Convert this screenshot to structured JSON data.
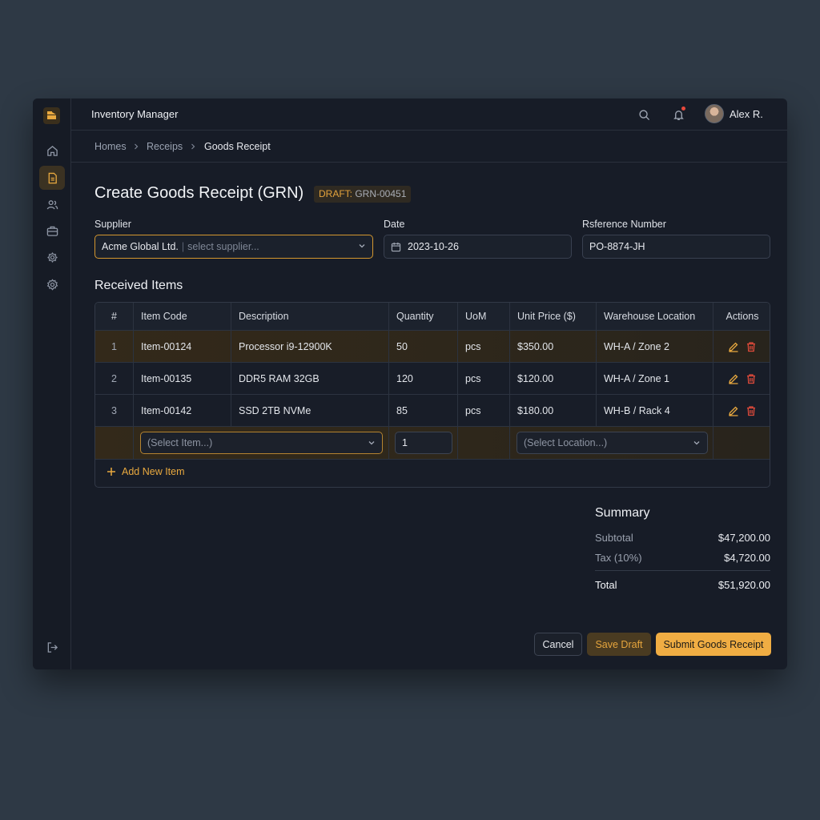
{
  "app": {
    "title": "Inventory Manager"
  },
  "user": {
    "name": "Alex R."
  },
  "breadcrumb": [
    "Homes",
    "Receips",
    "Goods Receipt"
  ],
  "page": {
    "title": "Create Goods Receipt (GRN)",
    "badge_label": "DRAFT:",
    "badge_value": "GRN-00451"
  },
  "form": {
    "supplier": {
      "label": "Supplier",
      "value": "Acme Global Ltd.",
      "placeholder": "select supplier..."
    },
    "date": {
      "label": "Date",
      "value": "2023-10-26"
    },
    "reference": {
      "label": "Rsference Number",
      "value": "PO-8874-JH"
    }
  },
  "items": {
    "title": "Received Items",
    "columns": [
      "#",
      "Item Code",
      "Description",
      "Quantity",
      "UoM",
      "Unit Price ($)",
      "Warehouse Location",
      "Actions"
    ],
    "rows": [
      {
        "n": "1",
        "code": "Item-00124",
        "desc": "Processor i9-12900K",
        "qty": "50",
        "uom": "pcs",
        "price": "$350.00",
        "loc": "WH-A / Zone 2"
      },
      {
        "n": "2",
        "code": "Item-00135",
        "desc": "DDR5 RAM 32GB",
        "qty": "120",
        "uom": "pcs",
        "price": "$120.00",
        "loc": "WH-A / Zone 1"
      },
      {
        "n": "3",
        "code": "Item-00142",
        "desc": "SSD 2TB NVMe",
        "qty": "85",
        "uom": "pcs",
        "price": "$180.00",
        "loc": "WH-B / Rack 4"
      }
    ],
    "new_row": {
      "item_placeholder": "(Select Item...)",
      "qty": "1",
      "location_placeholder": "(Select Location...)"
    },
    "add_label": "Add New Item"
  },
  "summary": {
    "title": "Summary",
    "subtotal_label": "Subtotal",
    "subtotal": "$47,200.00",
    "tax_label": "Tax (10%)",
    "tax": "$4,720.00",
    "total_label": "Total",
    "total": "$51,920.00"
  },
  "actions": {
    "cancel": "Cancel",
    "save_draft": "Save Draft",
    "submit": "Submit Goods Receipt"
  },
  "colors": {
    "accent": "#f0ad43",
    "danger": "#e24b3b",
    "background": "#171c27"
  },
  "icons": [
    "logo-icon",
    "home-icon",
    "document-icon",
    "users-icon",
    "briefcase-icon",
    "gear-icon",
    "settings-icon",
    "logout-icon",
    "search-icon",
    "bell-icon",
    "chevron-down-icon",
    "calendar-icon",
    "edit-icon",
    "trash-icon",
    "plus-icon"
  ]
}
